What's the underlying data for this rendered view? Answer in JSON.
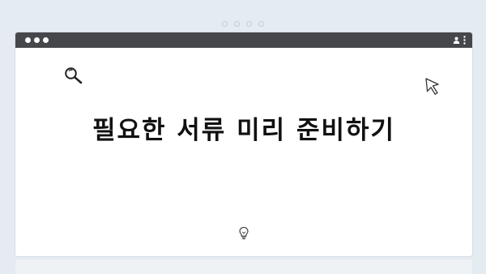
{
  "page": {
    "heading": "필요한 서류 미리 준비하기",
    "background_color": "#e4ebf1",
    "titlebar_color": "#46474b"
  },
  "icons": {
    "search": "search-icon",
    "cursor": "cursor-icon",
    "bulb": "lightbulb-icon",
    "user": "user-icon",
    "menu": "kebab-menu-icon"
  }
}
